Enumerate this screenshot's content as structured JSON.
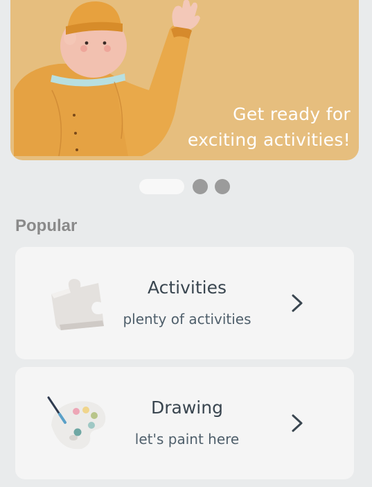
{
  "banner": {
    "line1": "Get ready for",
    "line2": "exciting activities!",
    "background_color": "#e6be7e"
  },
  "carousel": {
    "pages": 3,
    "active_index": 0
  },
  "section": {
    "title": "Popular"
  },
  "cards": [
    {
      "title": "Activities",
      "subtitle": "plenty of activities",
      "icon": "puzzle-piece-icon"
    },
    {
      "title": "Drawing",
      "subtitle": "let's paint here",
      "icon": "paint-palette-icon"
    }
  ],
  "colors": {
    "page_background": "#e9ebec",
    "card_background": "#f5f5f5",
    "title_text": "#3a4650",
    "section_title": "#8a8a8a",
    "dot_inactive": "#9b9b9b",
    "dot_active": "#f8f8f8"
  }
}
